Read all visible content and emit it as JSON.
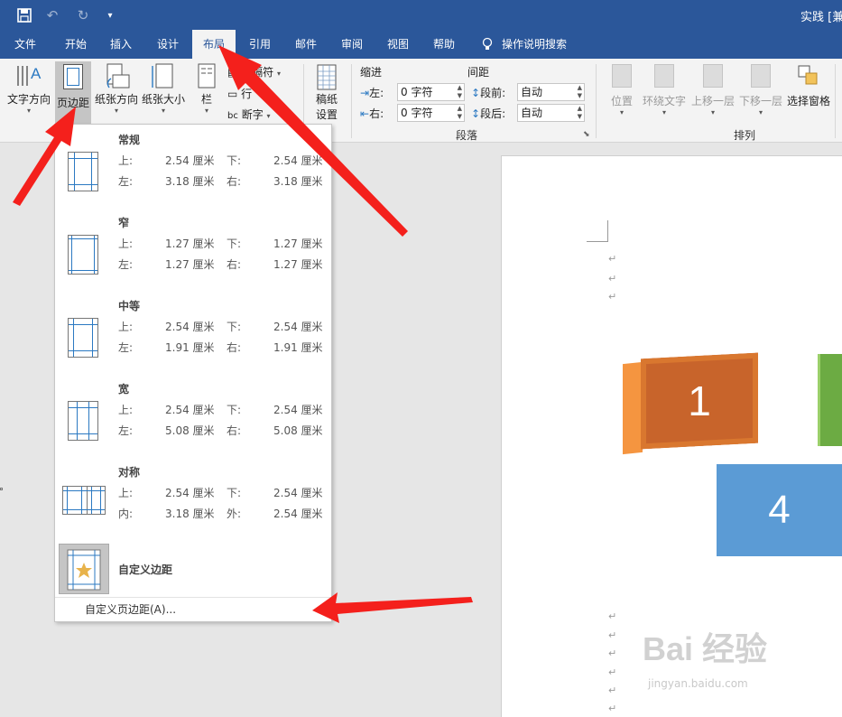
{
  "titlebar": {
    "doc_title": "实践 [兼",
    "icons": [
      "save-icon",
      "undo-icon",
      "redo-icon",
      "customize-qat-icon"
    ]
  },
  "tabs": [
    {
      "label": "文件"
    },
    {
      "label": "开始"
    },
    {
      "label": "插入"
    },
    {
      "label": "设计"
    },
    {
      "label": "布局",
      "active": true
    },
    {
      "label": "引用"
    },
    {
      "label": "邮件"
    },
    {
      "label": "审阅"
    },
    {
      "label": "视图"
    },
    {
      "label": "帮助"
    }
  ],
  "tell_me": "操作说明搜索",
  "ribbon": {
    "text_direction": "文字方向",
    "margins": "页边距",
    "orientation": "纸张方向",
    "size": "纸张大小",
    "columns": "栏",
    "breaks": "分隔符",
    "line_numbers": "行",
    "hyphenation": "断字",
    "draft_paper_1": "稿纸",
    "draft_paper_2": "设置",
    "indent_title": "缩进",
    "spacing_title": "间距",
    "indent_left_label": "左:",
    "indent_left_value": "0 字符",
    "indent_right_label": "右:",
    "indent_right_value": "0 字符",
    "before_label": "段前:",
    "before_value": "自动",
    "after_label": "段后:",
    "after_value": "自动",
    "paragraph_group": "段落",
    "position": "位置",
    "wrap_text": "环绕文字",
    "bring_forward": "上移一层",
    "send_backward": "下移一层",
    "selection_pane": "选择窗格",
    "arrange_group": "排列"
  },
  "margins_menu": {
    "options": [
      {
        "name": "常规",
        "l1a": "上:",
        "v1a": "2.54 厘米",
        "l1b": "下:",
        "v1b": "2.54 厘米",
        "l2a": "左:",
        "v2a": "3.18 厘米",
        "l2b": "右:",
        "v2b": "3.18 厘米"
      },
      {
        "name": "窄",
        "l1a": "上:",
        "v1a": "1.27 厘米",
        "l1b": "下:",
        "v1b": "1.27 厘米",
        "l2a": "左:",
        "v2a": "1.27 厘米",
        "l2b": "右:",
        "v2b": "1.27 厘米"
      },
      {
        "name": "中等",
        "l1a": "上:",
        "v1a": "2.54 厘米",
        "l1b": "下:",
        "v1b": "2.54 厘米",
        "l2a": "左:",
        "v2a": "1.91 厘米",
        "l2b": "右:",
        "v2b": "1.91 厘米"
      },
      {
        "name": "宽",
        "l1a": "上:",
        "v1a": "2.54 厘米",
        "l1b": "下:",
        "v1b": "2.54 厘米",
        "l2a": "左:",
        "v2a": "5.08 厘米",
        "l2b": "右:",
        "v2b": "5.08 厘米"
      },
      {
        "name": "对称",
        "l1a": "上:",
        "v1a": "2.54 厘米",
        "l1b": "下:",
        "v1b": "2.54 厘米",
        "l2a": "内:",
        "v2a": "3.18 厘米",
        "l2b": "外:",
        "v2b": "2.54 厘米"
      }
    ],
    "custom_name": "自定义边距",
    "custom_link": "自定义页边距(A)..."
  },
  "document": {
    "paragraph_mark": "↵",
    "shape_1_text": "1",
    "shape_4_text": "4"
  },
  "watermark": {
    "main": "Bai 经验",
    "sub": "jingyan.baidu.com"
  },
  "colors": {
    "accent": "#2b579a",
    "arrow": "#f4201c",
    "shape_orange": "#c8642b",
    "shape_blue": "#5b9bd5",
    "shape_green": "#6cab43"
  }
}
